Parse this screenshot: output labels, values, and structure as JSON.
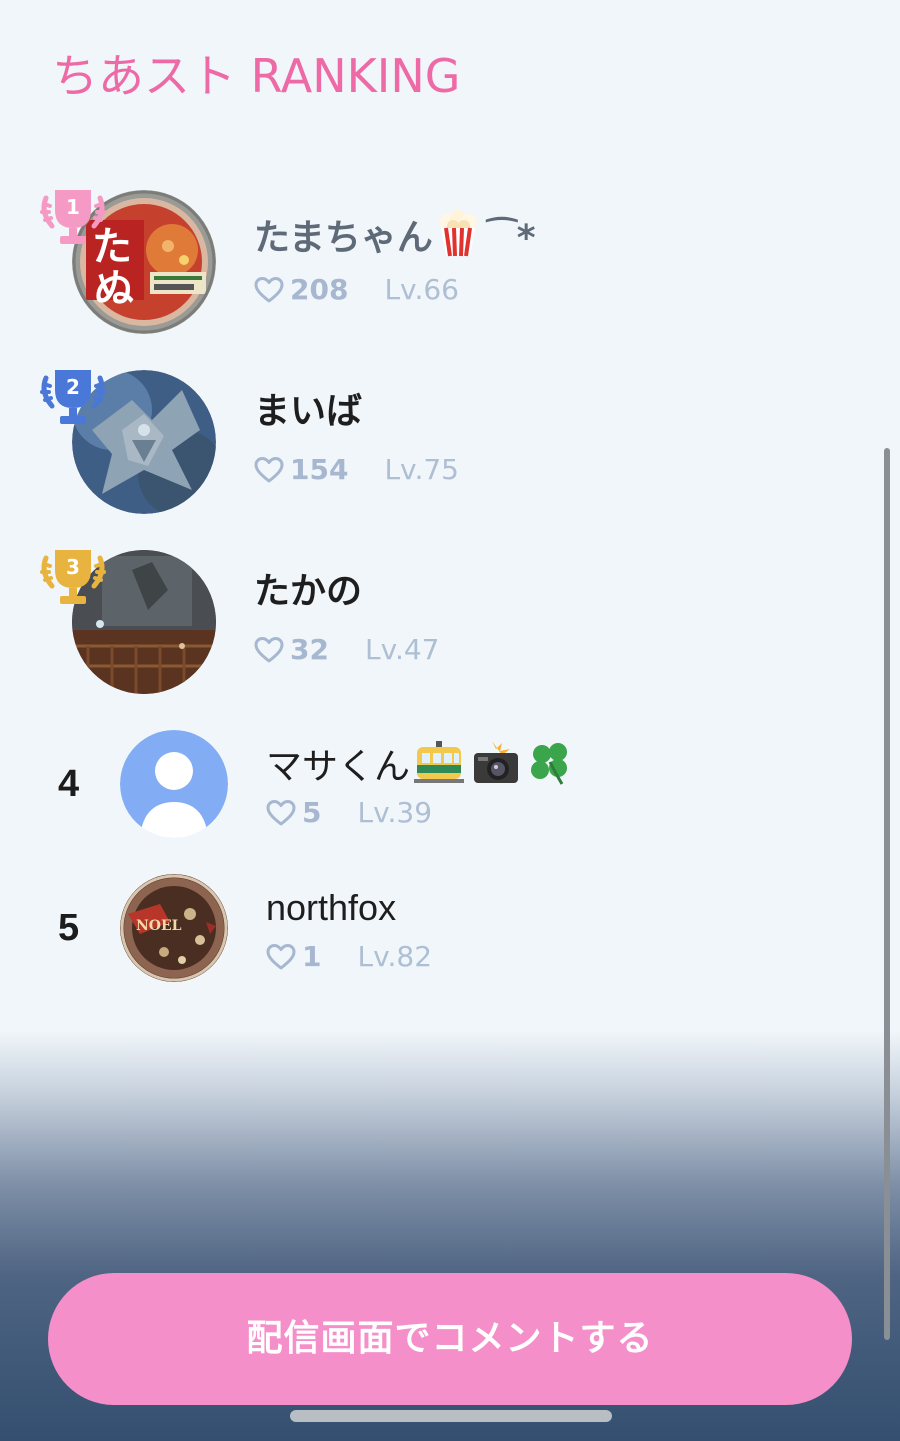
{
  "header": {
    "title": "ちあスト RANKING"
  },
  "rankings": [
    {
      "rank": "1",
      "name": "たまちゃん",
      "name_suffix": "⁀*",
      "emojis": [
        "popcorn"
      ],
      "likes": "208",
      "level": "Lv.66",
      "trophy_color": "#f49ac4"
    },
    {
      "rank": "2",
      "name": "まいば",
      "likes": "154",
      "level": "Lv.75",
      "trophy_color": "#4a78d8"
    },
    {
      "rank": "3",
      "name": "たかの",
      "likes": "32",
      "level": "Lv.47",
      "trophy_color": "#e8b43f"
    },
    {
      "rank": "4",
      "name": "マサくん",
      "emojis": [
        "tram",
        "camera-flash",
        "four-leaf-clover"
      ],
      "likes": "5",
      "level": "Lv.39"
    },
    {
      "rank": "5",
      "name": "northfox",
      "likes": "1",
      "level": "Lv.82"
    }
  ],
  "cta": {
    "label": "配信画面でコメントする"
  },
  "colors": {
    "accent_pink": "#ee6aa7",
    "button_pink": "#f48fc9",
    "muted_blue": "#9fb0c8",
    "background": "#f1f6fa"
  }
}
